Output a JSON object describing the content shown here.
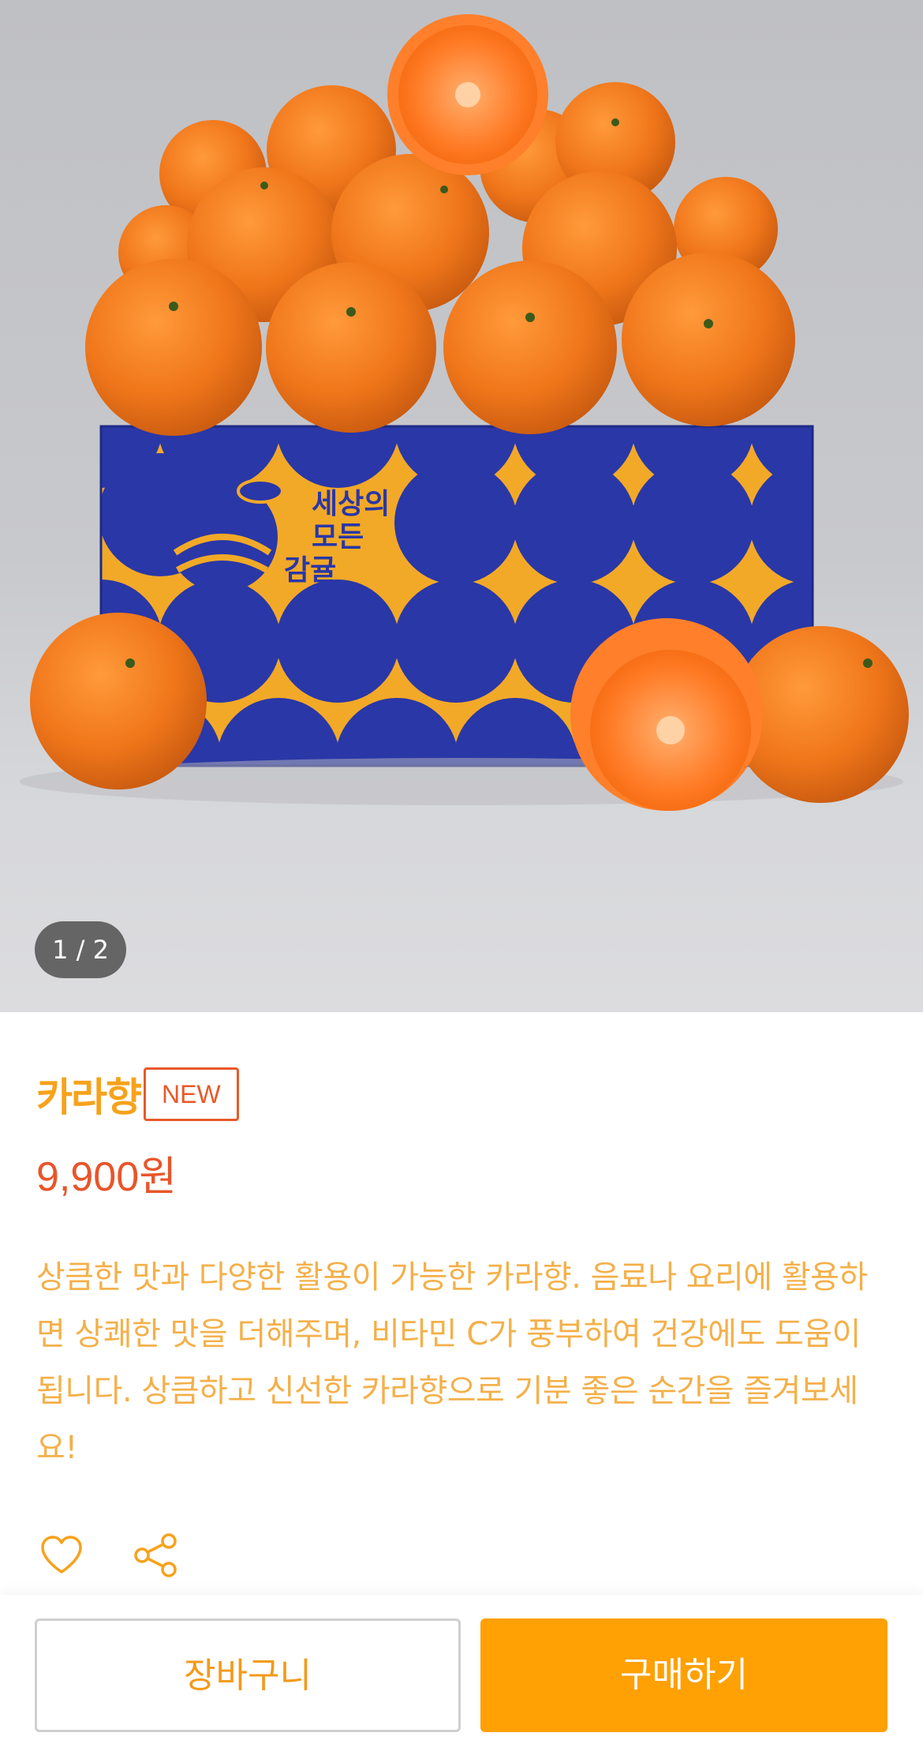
{
  "gallery": {
    "counter": "1 / 2",
    "box_text": [
      "세상의",
      "모든",
      "감귤"
    ]
  },
  "product": {
    "name": "카라향",
    "badge": "NEW",
    "price": "9,900원",
    "description": "상큼한 맛과 다양한 활용이 가능한 카라향. 음료나 요리에 활용하면 상쾌한 맛을 더해주며, 비타민 C가 풍부하여 건강에도 도움이 됩니다. 상큼하고 신선한 카라향으로 기분 좋은 순간을 즐겨보세요!"
  },
  "actions": {
    "like_icon": "heart-icon",
    "share_icon": "share-icon"
  },
  "bottom_bar": {
    "cart_label": "장바구니",
    "buy_label": "구매하기"
  },
  "colors": {
    "accent": "#ffa004",
    "name": "#f7a21b",
    "price": "#e8552a",
    "description": "#f4b04a",
    "box_blue": "#2a37a6",
    "box_yellow": "#f2a928"
  }
}
